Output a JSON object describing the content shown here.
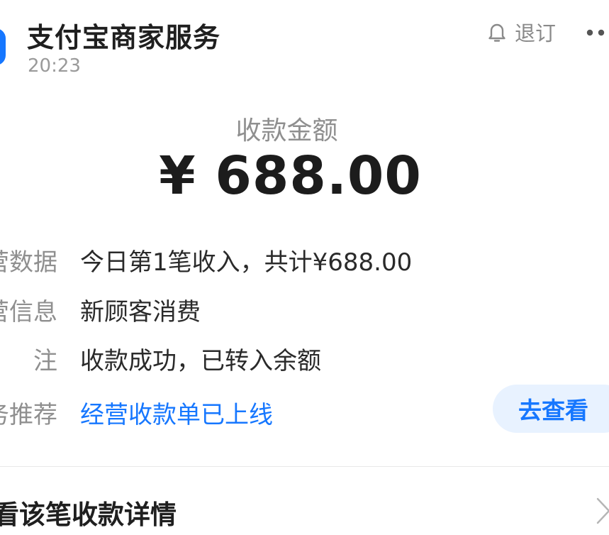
{
  "header": {
    "title": "支付宝商家服务",
    "time": "20:23",
    "unsubscribe_label": "退订",
    "icons": {
      "logo": "alipay-logo-icon",
      "bell": "bell-icon",
      "more": "more-dots-icon"
    },
    "brand_color": "#1677ff"
  },
  "amount": {
    "label": "收款金额",
    "value": "¥ 688.00"
  },
  "rows": [
    {
      "label": "营数据",
      "value": "今日第1笔收入，共计¥688.00"
    },
    {
      "label": "营信息",
      "value": "新顾客消费"
    },
    {
      "label": "注",
      "value": "收款成功，已转入余额"
    },
    {
      "label": "务推荐",
      "value": "经营收款单已上线",
      "button": "去查看"
    }
  ],
  "footer": {
    "details_label": "看该笔收款详情",
    "chevron_icon": "chevron-right-icon"
  }
}
